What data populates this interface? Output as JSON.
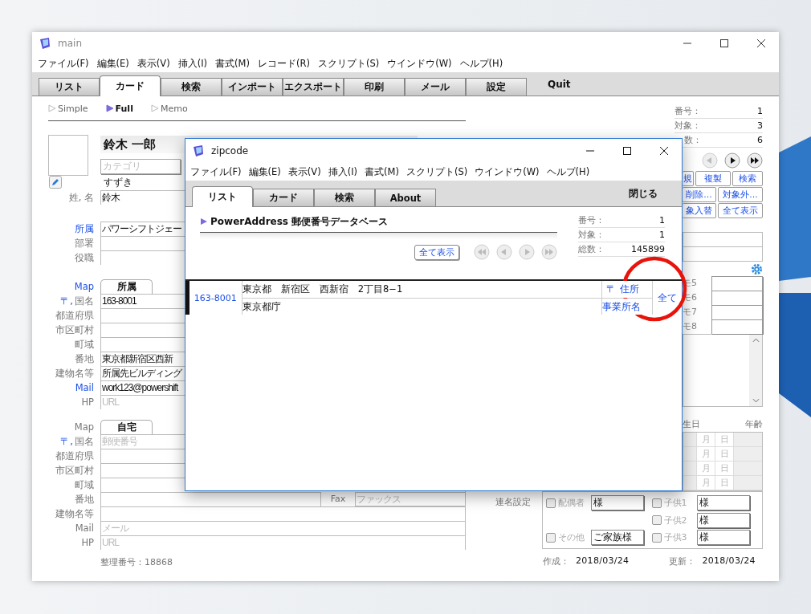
{
  "main_window": {
    "title": "main",
    "menu": [
      "ファイル(F)",
      "編集(E)",
      "表示(V)",
      "挿入(I)",
      "書式(M)",
      "レコード(R)",
      "スクリプト(S)",
      "ウインドウ(W)",
      "ヘルプ(H)"
    ],
    "tabs": [
      {
        "label": "リスト",
        "selected": false
      },
      {
        "label": "カード",
        "selected": true
      },
      {
        "label": "検索",
        "selected": false
      },
      {
        "label": "インポート",
        "selected": false
      },
      {
        "label": "エクスポート",
        "selected": false
      },
      {
        "label": "印刷",
        "selected": false
      },
      {
        "label": "メール",
        "selected": false
      },
      {
        "label": "設定",
        "selected": false
      }
    ],
    "quit": "Quit"
  },
  "card": {
    "view_modes": [
      {
        "label": "Simple",
        "selected": false
      },
      {
        "label": "Full",
        "selected": true
      },
      {
        "label": "Memo",
        "selected": false
      }
    ],
    "name": "鈴木 一郎",
    "category_placeholder": "カテゴリ",
    "furigana": "すずき",
    "name_row": {
      "label": "姓, 名",
      "value": "鈴木"
    },
    "org_rows": [
      {
        "label": "所属",
        "link": true,
        "value": "パワーシフトジェー"
      },
      {
        "label": "部署",
        "link": false
      },
      {
        "label": "役職",
        "link": false
      }
    ],
    "business_address": {
      "map": "Map",
      "map_link": true,
      "tab": "所属",
      "rows": [
        {
          "prefix": "〒,",
          "label": "国名",
          "link": true,
          "value": "163-8001"
        },
        {
          "label": "都道府県",
          "link": false
        },
        {
          "label": "市区町村",
          "link": false
        },
        {
          "label": "町域",
          "link": false
        },
        {
          "label": "番地",
          "link": false,
          "value": "東京都新宿区西新"
        },
        {
          "label": "建物名等",
          "link": false,
          "value": "所属先ビルディング"
        },
        {
          "label": "Mail",
          "link": true,
          "value": "work123@powershift"
        },
        {
          "label": "HP",
          "link": false,
          "placeholder": "URL"
        }
      ]
    },
    "home_address": {
      "map": "Map",
      "map_link": false,
      "tab": "自宅",
      "rows": [
        {
          "prefix": "〒,",
          "label": "国名",
          "link": true,
          "placeholder": "郵便番号"
        },
        {
          "label": "都道府県",
          "link": false
        },
        {
          "label": "市区町村",
          "link": false
        },
        {
          "label": "町域",
          "link": false
        },
        {
          "label": "番地",
          "link": false,
          "side": {
            "label": "Fax",
            "placeholder": "ファックス"
          }
        },
        {
          "label": "建物名等",
          "link": false
        },
        {
          "label": "Mail",
          "link": false,
          "placeholder": "メール"
        },
        {
          "label": "HP",
          "link": false,
          "placeholder": "URL"
        }
      ]
    },
    "record_no": "整理番号：18868",
    "counters": [
      {
        "label": "番号：",
        "value": "1"
      },
      {
        "label": "対象：",
        "value": "3"
      },
      {
        "label": "数：",
        "value": "6"
      }
    ],
    "action_rows": [
      [
        "規",
        "複製",
        "検索"
      ],
      [
        "削除...",
        "対象外..."
      ],
      [
        "象入替",
        "全て表示"
      ]
    ],
    "memos": [
      "モ5",
      "モ6",
      "モ7",
      "モ8"
    ],
    "birthday": {
      "heading": "生日",
      "age_heading": "年齢",
      "rows": [
        {
          "month": "月",
          "day": "日"
        },
        {
          "month": "月",
          "day": "日"
        },
        {
          "month": "月",
          "day": "日"
        },
        {
          "month": "月",
          "day": "日"
        }
      ]
    },
    "joint_names": {
      "label": "連名設定",
      "left": [
        {
          "label": "配偶者",
          "checked": false,
          "value": "様"
        },
        {
          "label": "その他",
          "checked": false,
          "value": "ご家族様"
        }
      ],
      "right": [
        {
          "label": "子供1",
          "checked": false,
          "value": "様"
        },
        {
          "label": "子供2",
          "checked": false,
          "value": "様"
        },
        {
          "label": "子供3",
          "checked": false,
          "value": "様"
        }
      ]
    },
    "created": {
      "label": "作成：",
      "value": "2018/03/24"
    },
    "updated": {
      "label": "更新：",
      "value": "2018/03/24"
    }
  },
  "zipcode_window": {
    "title": "zipcode",
    "menu": [
      "ファイル(F)",
      "編集(E)",
      "表示(V)",
      "挿入(I)",
      "書式(M)",
      "スクリプト(S)",
      "ウインドウ(W)",
      "ヘルプ(H)"
    ],
    "tabs": [
      {
        "label": "リスト",
        "selected": true
      },
      {
        "label": "カード",
        "selected": false
      },
      {
        "label": "検索",
        "selected": false
      },
      {
        "label": "About",
        "selected": false
      }
    ],
    "close": "閉じる",
    "heading": "PowerAddress 郵便番号データベース",
    "show_all": "全て表示",
    "counters": [
      {
        "label": "番号：",
        "value": "1"
      },
      {
        "label": "対象：",
        "value": "1"
      },
      {
        "label": "総数：",
        "value": "145899"
      }
    ],
    "results": [
      {
        "selected": true,
        "zip": "163-8001",
        "address": "東京都　新宿区　西新宿　2丁目8−1",
        "name": "東京都庁",
        "zip_link": "〒",
        "address_link": "住所",
        "office_link": "事業所名",
        "all_link": "全て"
      }
    ]
  }
}
